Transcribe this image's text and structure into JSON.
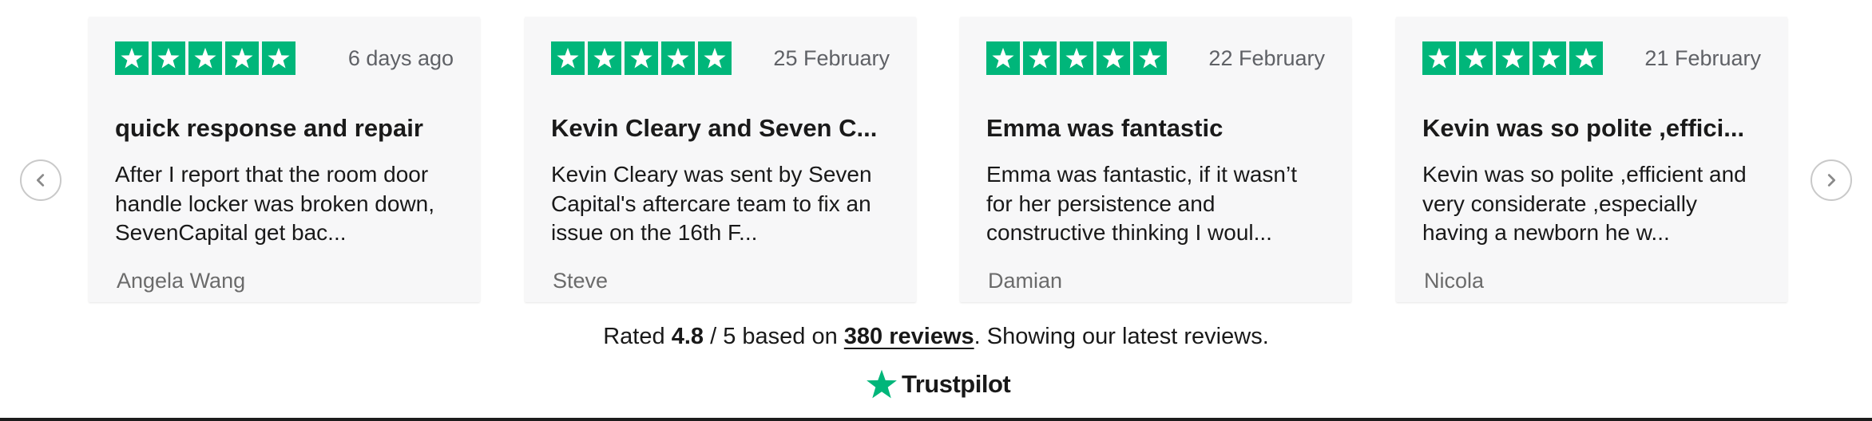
{
  "nav": {
    "prev_icon": "chevron-left-icon",
    "next_icon": "chevron-right-icon"
  },
  "colors": {
    "star_green": "#00b67a",
    "card_bg": "#f7f7f8"
  },
  "reviews": [
    {
      "rating": 5,
      "date": "6 days ago",
      "title": "quick response and repair",
      "text": "After I report that the room door handle locker was broken down, SevenCapital get bac...",
      "author": "Angela Wang"
    },
    {
      "rating": 5,
      "date": "25 February",
      "title": "Kevin Cleary and Seven C...",
      "text": "Kevin Cleary was sent by Seven Capital's aftercare team to fix an issue on the 16th F...",
      "author": "Steve"
    },
    {
      "rating": 5,
      "date": "22 February",
      "title": "Emma was fantastic",
      "text": "Emma was fantastic, if it wasn’t for her persistence and constructive thinking I woul...",
      "author": "Damian"
    },
    {
      "rating": 5,
      "date": "21 February",
      "title": "Kevin was so polite ,effici...",
      "text": "Kevin was so polite ,efficient and very considerate ,especially having a newborn he w...",
      "author": "Nicola"
    }
  ],
  "summary": {
    "rated_prefix": "Rated",
    "score": "4.8",
    "out_of": "/ 5 based on",
    "reviews_link": "380 reviews",
    "suffix": ". Showing our latest reviews."
  },
  "brand": {
    "name": "Trustpilot",
    "icon": "trustpilot-star-icon"
  }
}
